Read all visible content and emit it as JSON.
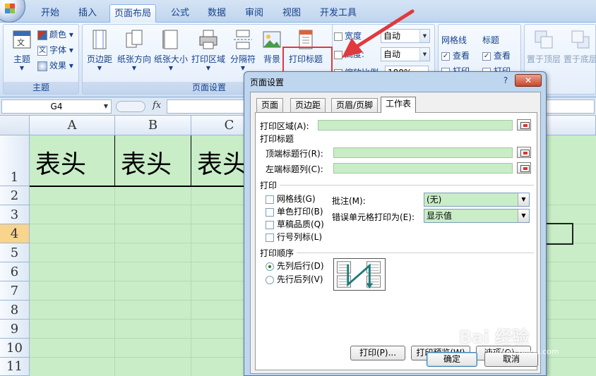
{
  "ribbon": {
    "tabs": [
      "开始",
      "插入",
      "页面布局",
      "公式",
      "数据",
      "审阅",
      "视图",
      "开发工具"
    ],
    "active_tab": "页面布局",
    "theme_group": {
      "label": "主题",
      "theme_button": "主题",
      "colors": "颜色",
      "fonts": "字体",
      "effects": "效果"
    },
    "page_setup_group": {
      "label": "页面设置",
      "margins": "页边距",
      "orientation": "纸张方向",
      "size": "纸张大小",
      "print_area": "打印区域",
      "breaks": "分隔符",
      "background": "背景",
      "print_titles": "打印标题"
    },
    "scale_group": {
      "width_label": "宽度",
      "width_value": "自动",
      "height_label": "高度:",
      "height_value": "自动",
      "scale_label": "缩放比例",
      "scale_value": "100%"
    },
    "sheet_options_group": {
      "gridlines": "网格线",
      "headings": "标题",
      "view": "查看",
      "print": "打印"
    },
    "arrange_group": {
      "bring_front": "置于顶层",
      "send_back": "置于底层"
    }
  },
  "formula_bar": {
    "name_box": "G4",
    "fx": "fx"
  },
  "sheet": {
    "columns": [
      "A",
      "B",
      "C"
    ],
    "rows": [
      "1",
      "2",
      "3",
      "4",
      "5",
      "6",
      "7",
      "8",
      "9",
      "10",
      "11"
    ],
    "header_cells": [
      "表头",
      "表头",
      "表头"
    ]
  },
  "dialog": {
    "title": "页面设置",
    "help": "?",
    "close": "✕",
    "tabs": [
      "页面",
      "页边距",
      "页眉/页脚",
      "工作表"
    ],
    "active_tab": "工作表",
    "print_area_label": "打印区域(A):",
    "print_titles_label": "打印标题",
    "top_rows_label": "顶端标题行(R):",
    "left_cols_label": "左端标题列(C):",
    "print_section_label": "打印",
    "checkboxes": [
      "网格线(G)",
      "单色打印(B)",
      "草稿品质(Q)",
      "行号列标(L)"
    ],
    "comments_label": "批注(M):",
    "comments_value": "(无)",
    "errors_label": "错误单元格打印为(E):",
    "errors_value": "显示值",
    "order_label": "打印顺序",
    "order_options": [
      "先列后行(D)",
      "先行后列(V)"
    ],
    "buttons": {
      "print": "打印(P)...",
      "preview": "打印预览(W)",
      "options": "选项(O)...",
      "ok": "确定",
      "cancel": "取消"
    }
  },
  "watermark": {
    "main": "Bai 经验",
    "sub": "jingyan.baidu.com"
  },
  "colors": {
    "ribbon_text": "#15428b",
    "highlight": "#e0393e",
    "cell_fill": "#c8edc7"
  }
}
